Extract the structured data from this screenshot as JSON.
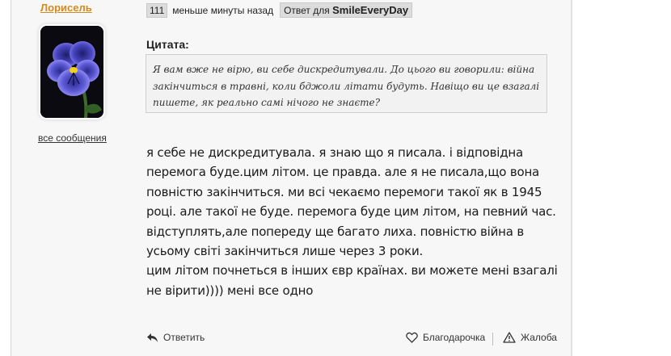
{
  "author": {
    "name": "Лорисель",
    "all_messages_link": "все сообщения"
  },
  "post": {
    "number": "111",
    "time": "меньше минуты назад",
    "reply_prefix": "Ответ для",
    "reply_to_user": "SmileEveryDay"
  },
  "quote": {
    "title": "Цитата:",
    "lines": [
      "Я вам вже не вірю, ви себе дискредитували. До цього ви говорили: війна",
      "закінчиться в травні, коли бджоли літати будуть. Навіщо ви це взагалі",
      "пишете, як реально самі нічого не знаєте?"
    ]
  },
  "body_lines": [
    "я себе не дискредитувала. я знаю що я писала. і відповідна",
    "перемога буде.цим літом. це правда. але я не писала,що вона",
    "повністю закінчиться. ми всі чекаємо перемоги такої як в 1945",
    "році. але такої не буде. перемога буде цим літом, на певний час.",
    "відступлять,але попереду ще багато лиха. повністю війна в",
    "усьому світі закінчиться лише через 3 роки.",
    "цим літом почнеться в інших євр країнах. ви можете мені взагалі",
    "не вірити)))) мені все одно"
  ],
  "actions": {
    "reply": "Ответить",
    "thanks": "Благодарочка",
    "report": "Жалоба"
  },
  "icons": {
    "reply": "reply-arrow-icon",
    "thanks": "heart-icon",
    "report": "warning-triangle-icon",
    "avatar": "pansy-flower-avatar"
  },
  "colors": {
    "author_link": "#d38a1c",
    "card_bg": "#f7f7f7",
    "quote_bg": "#f2f2f2",
    "badge_bg": "#dcdcdc"
  }
}
